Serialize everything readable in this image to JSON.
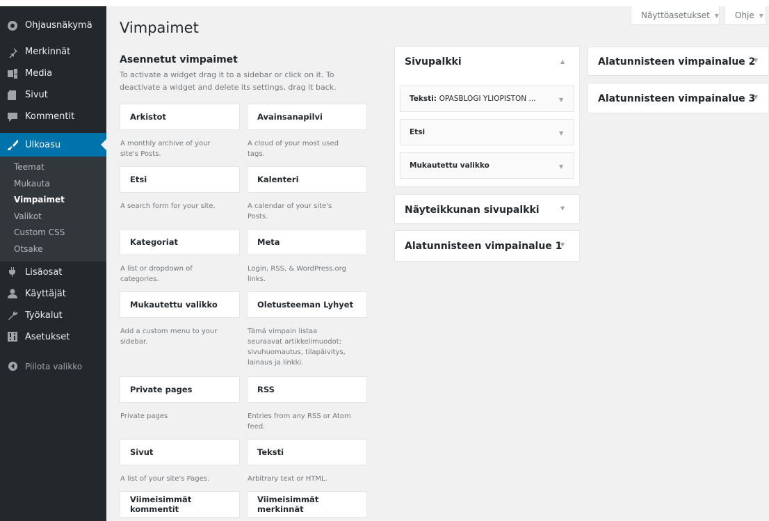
{
  "sidebar": {
    "items": [
      {
        "label": "Ohjausnäkymä",
        "icon": "dashboard-icon"
      },
      {
        "label": "Merkinnät",
        "icon": "pin-icon"
      },
      {
        "label": "Media",
        "icon": "media-icon"
      },
      {
        "label": "Sivut",
        "icon": "page-icon"
      },
      {
        "label": "Kommentit",
        "icon": "comment-icon"
      },
      {
        "label": "Ulkoasu",
        "icon": "paintbrush-icon"
      },
      {
        "label": "Lisäosat",
        "icon": "plugin-icon"
      },
      {
        "label": "Käyttäjät",
        "icon": "users-icon"
      },
      {
        "label": "Työkalut",
        "icon": "wrench-icon"
      },
      {
        "label": "Asetukset",
        "icon": "settings-icon"
      }
    ],
    "submenu": [
      "Teemat",
      "Mukauta",
      "Vimpaimet",
      "Valikot",
      "Custom CSS",
      "Otsake"
    ],
    "collapse_label": "Piilota valikko",
    "active_color": "#0073aa"
  },
  "top": {
    "screen_options": "Näyttöasetukset",
    "help": "Ohje",
    "arrow": "▼"
  },
  "page": {
    "title": "Vimpaimet",
    "available_title": "Asennetut vimpaimet",
    "available_desc": "To activate a widget drag it to a sidebar or click on it. To deactivate a widget and delete its settings, drag it back."
  },
  "widgets": [
    {
      "name": "Arkistot",
      "desc": "A monthly archive of your site's Posts."
    },
    {
      "name": "Avainsanapilvi",
      "desc": "A cloud of your most used tags."
    },
    {
      "name": "Etsi",
      "desc": "A search form for your site."
    },
    {
      "name": "Kalenteri",
      "desc": "A calendar of your site's Posts."
    },
    {
      "name": "Kategoriat",
      "desc": "A list or dropdown of categories."
    },
    {
      "name": "Meta",
      "desc": "Login, RSS, & WordPress.org links."
    },
    {
      "name": "Mukautettu valikko",
      "desc": "Add a custom menu to your sidebar."
    },
    {
      "name": "Oletusteeman Lyhyet",
      "desc": "Tämä vimpain listaa seuraavat artikkelimuodot: sivuhuomautus, tilapäivitys, lainaus ja linkki."
    },
    {
      "name": "Private pages",
      "desc": "Private pages"
    },
    {
      "name": "RSS",
      "desc": "Entries from any RSS or Atom feed."
    },
    {
      "name": "Sivut",
      "desc": "A list of your site's Pages."
    },
    {
      "name": "Teksti",
      "desc": "Arbitrary text or HTML."
    },
    {
      "name": "Viimeisimmät kommentit",
      "desc": ""
    },
    {
      "name": "Viimeisimmät merkinnät",
      "desc": ""
    }
  ],
  "areas": {
    "sivupalkki": {
      "title": "Sivupalkki",
      "widgets": [
        {
          "name": "Teksti:",
          "subtitle": "OPASBLOGI YLIOPISTON ..."
        },
        {
          "name": "Etsi",
          "subtitle": ""
        },
        {
          "name": "Mukautettu valikko",
          "subtitle": ""
        }
      ]
    },
    "nayteikkuna": {
      "title": "Näyteikkunan sivupalkki"
    },
    "footer1": {
      "title": "Alatunnisteen vimpainalue 1"
    },
    "footer2": {
      "title": "Alatunnisteen vimpainalue 2"
    },
    "footer3": {
      "title": "Alatunnisteen vimpainalue 3"
    },
    "collapse_arrow": "▲",
    "expand_arrow": "▼"
  }
}
